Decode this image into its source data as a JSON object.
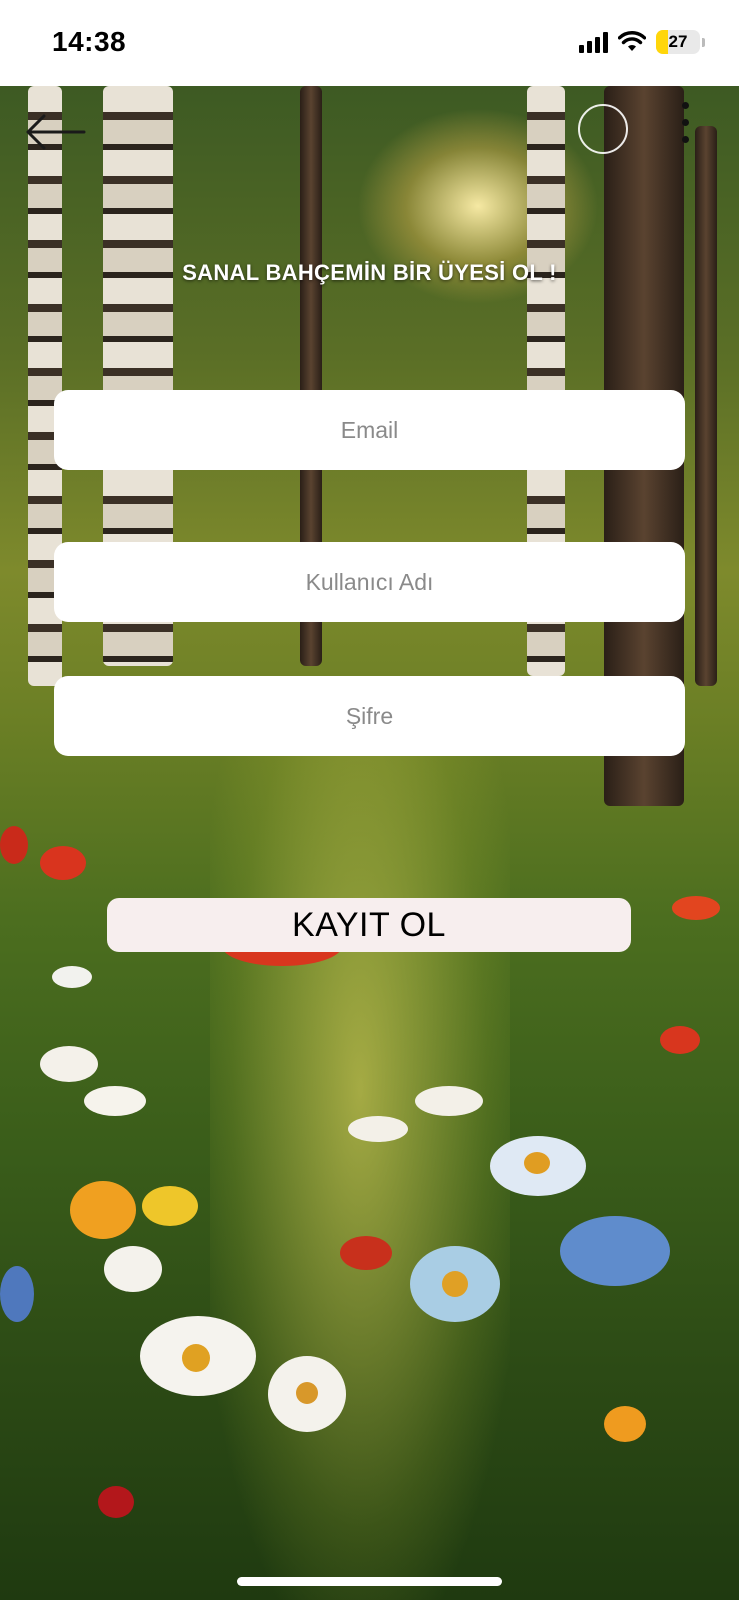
{
  "status_bar": {
    "time": "14:38",
    "battery_level": "27",
    "battery_fraction": 0.27,
    "icons": [
      "signal-icon",
      "wifi-icon",
      "battery-charging-icon"
    ]
  },
  "header": {
    "icons": [
      "back-arrow-icon",
      "close-circle-icon",
      "more-vertical-icon"
    ]
  },
  "page": {
    "title": "SANAL BAHÇEMİN BİR ÜYESİ OL !"
  },
  "form": {
    "email_placeholder": "Email",
    "username_placeholder": "Kullanıcı Adı",
    "password_placeholder": "Şifre",
    "submit_label": "KAYIT OL"
  },
  "colors": {
    "button_bg": "#f7eeee",
    "field_bg": "#ffffff",
    "battery": "#ffd60a"
  }
}
